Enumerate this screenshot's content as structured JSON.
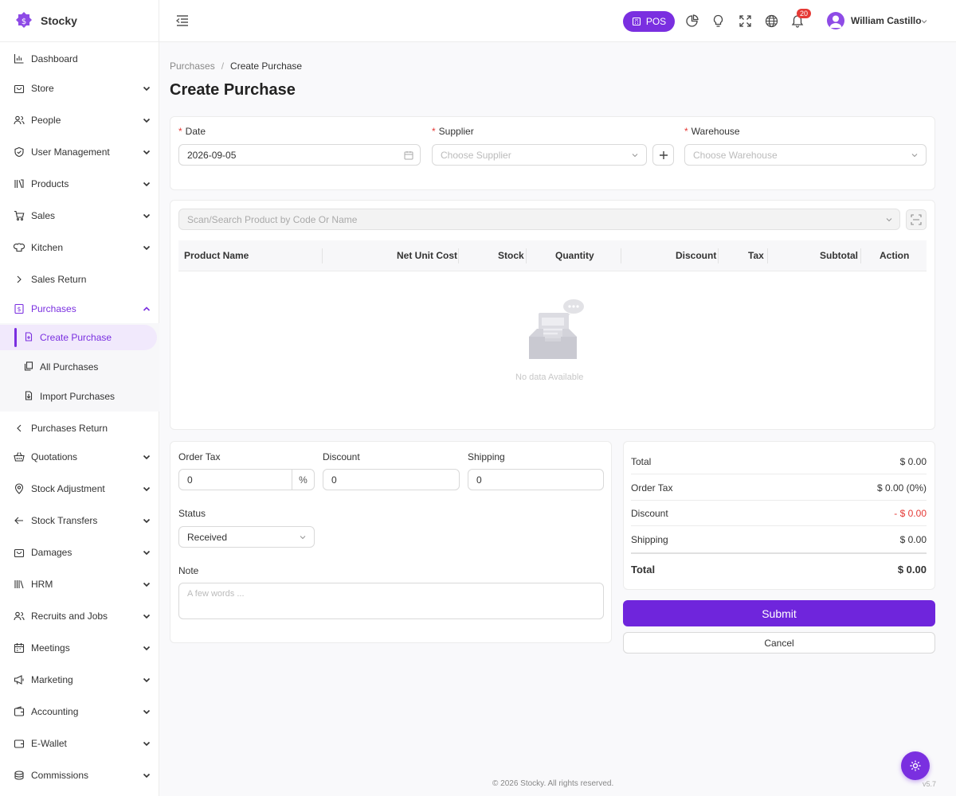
{
  "brand": {
    "name": "Stocky"
  },
  "header": {
    "pos_label": "POS",
    "notification_count": "20",
    "user_name": "William Castillo"
  },
  "sidebar": {
    "items": [
      {
        "label": "Dashboard",
        "icon": "chart-bars-icon",
        "chevron": ""
      },
      {
        "label": "Store",
        "icon": "store-bag-icon",
        "chevron": "down"
      },
      {
        "label": "People",
        "icon": "people-icon",
        "chevron": "down"
      },
      {
        "label": "User Management",
        "icon": "shield-icon",
        "chevron": "down"
      },
      {
        "label": "Products",
        "icon": "books-icon",
        "chevron": "down"
      },
      {
        "label": "Sales",
        "icon": "cart-icon",
        "chevron": "down"
      },
      {
        "label": "Kitchen",
        "icon": "chef-hat-icon",
        "chevron": "down"
      },
      {
        "label": "Sales Return",
        "icon": "chevron-right-icon",
        "chevron": ""
      },
      {
        "label": "Purchases",
        "icon": "purchase-receipt-icon",
        "chevron": "up"
      },
      {
        "label": "Purchases Return",
        "icon": "chevron-left-icon",
        "chevron": ""
      },
      {
        "label": "Quotations",
        "icon": "basket-icon",
        "chevron": "down"
      },
      {
        "label": "Stock Adjustment",
        "icon": "location-pin-icon",
        "chevron": "down"
      },
      {
        "label": "Stock Transfers",
        "icon": "arrow-left-icon",
        "chevron": "down"
      },
      {
        "label": "Damages",
        "icon": "damage-bag-icon",
        "chevron": "down"
      },
      {
        "label": "HRM",
        "icon": "library-icon",
        "chevron": "down"
      },
      {
        "label": "Recruits and Jobs",
        "icon": "recruit-icon",
        "chevron": "down"
      },
      {
        "label": "Meetings",
        "icon": "calendar-icon",
        "chevron": "down"
      },
      {
        "label": "Marketing",
        "icon": "megaphone-icon",
        "chevron": "down"
      },
      {
        "label": "Accounting",
        "icon": "wallet-icon",
        "chevron": "down"
      },
      {
        "label": "E-Wallet",
        "icon": "e-wallet-icon",
        "chevron": "down"
      },
      {
        "label": "Commissions",
        "icon": "coins-icon",
        "chevron": "down"
      }
    ],
    "purchases_sub": [
      {
        "label": "Create Purchase",
        "icon": "file-plus-icon"
      },
      {
        "label": "All Purchases",
        "icon": "copy-icon"
      },
      {
        "label": "Import Purchases",
        "icon": "file-import-icon"
      }
    ]
  },
  "breadcrumb": {
    "parent": "Purchases",
    "current": "Create Purchase"
  },
  "page": {
    "title": "Create Purchase"
  },
  "form": {
    "date_label": "Date",
    "date_value": "2026-09-05",
    "supplier_label": "Supplier",
    "supplier_placeholder": "Choose Supplier",
    "warehouse_label": "Warehouse",
    "warehouse_placeholder": "Choose Warehouse",
    "search_placeholder": "Scan/Search Product by Code Or Name"
  },
  "table": {
    "columns": [
      "Product Name",
      "Net Unit Cost",
      "Stock",
      "Quantity",
      "Discount",
      "Tax",
      "Subtotal",
      "Action"
    ],
    "empty_text": "No data Available"
  },
  "options": {
    "order_tax_label": "Order Tax",
    "order_tax_value": "0",
    "percent_symbol": "%",
    "discount_label": "Discount",
    "discount_value": "0",
    "shipping_label": "Shipping",
    "shipping_value": "0",
    "status_label": "Status",
    "status_value": "Received",
    "note_label": "Note",
    "note_placeholder": "A few words ..."
  },
  "summary": {
    "total_label": "Total",
    "total_value": "$ 0.00",
    "order_tax_label": "Order Tax",
    "order_tax_value": "$ 0.00 (0%)",
    "discount_label": "Discount",
    "discount_value": "- $ 0.00",
    "shipping_label": "Shipping",
    "shipping_value": "$ 0.00",
    "grand_label": "Total",
    "grand_value": "$ 0.00"
  },
  "actions": {
    "submit": "Submit",
    "cancel": "Cancel"
  },
  "footer": {
    "copyright": "© 2026 Stocky. All rights reserved.",
    "version": "v5.7"
  },
  "colors": {
    "accent": "#7a2fe0",
    "danger": "#e53935"
  }
}
